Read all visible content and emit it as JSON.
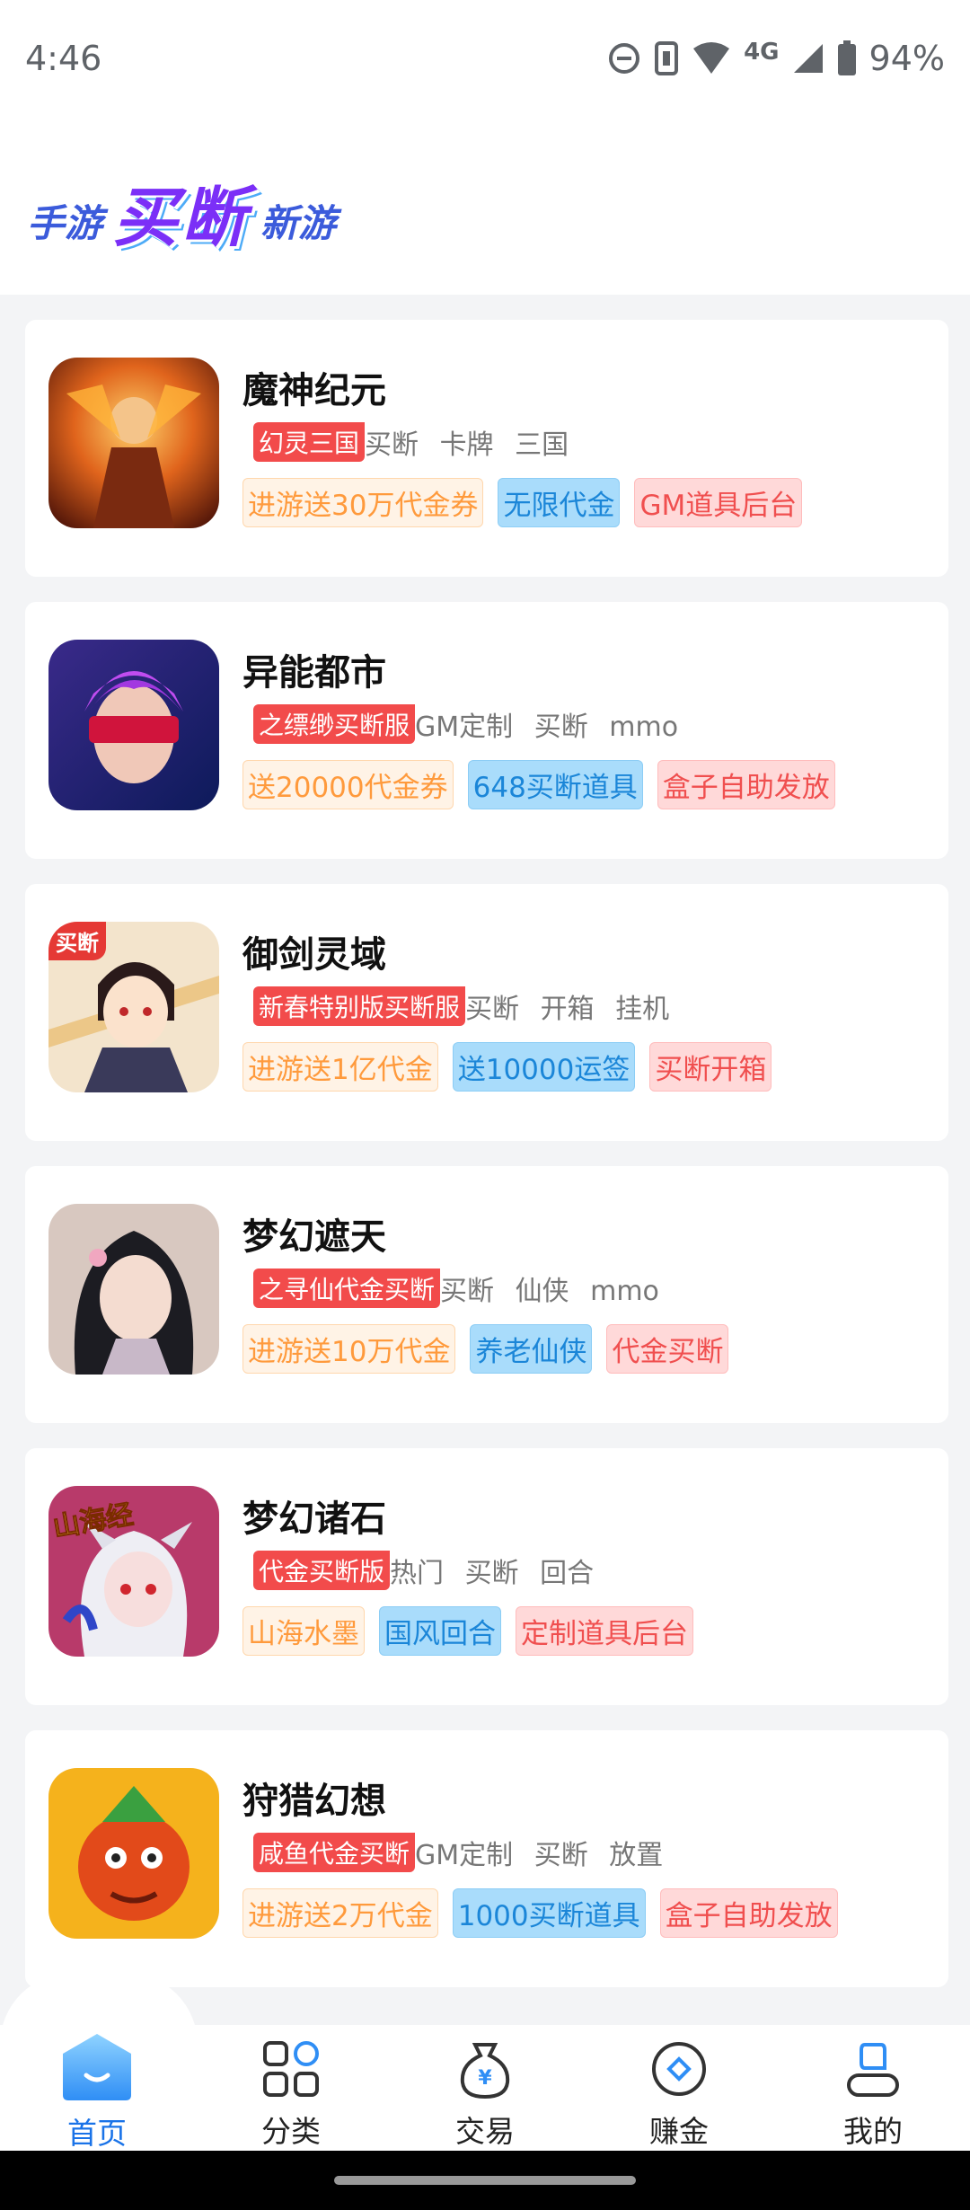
{
  "status_bar": {
    "time": "4:46",
    "network": "4G",
    "battery": "94%"
  },
  "header": {
    "logo_left": "手游",
    "logo_main": "买断",
    "logo_right": "新游"
  },
  "games": [
    {
      "title": "魔神纪元",
      "badge": "幻灵三国",
      "tags": [
        "买断",
        "卡牌",
        "三国"
      ],
      "pills": [
        {
          "text": "进游送30万代金券",
          "color": "orange"
        },
        {
          "text": "无限代金",
          "color": "blue"
        },
        {
          "text": "GM道具后台",
          "color": "pink"
        }
      ]
    },
    {
      "title": "异能都市",
      "badge": "之缥缈买断服",
      "tags": [
        "GM定制",
        "买断",
        "mmo"
      ],
      "pills": [
        {
          "text": "送20000代金券",
          "color": "orange"
        },
        {
          "text": "648买断道具",
          "color": "blue"
        },
        {
          "text": "盒子自助发放",
          "color": "pink"
        }
      ]
    },
    {
      "title": "御剑灵域",
      "badge": "新春特别版买断服",
      "tags": [
        "买断",
        "开箱",
        "挂机"
      ],
      "pills": [
        {
          "text": "进游送1亿代金",
          "color": "orange"
        },
        {
          "text": "送10000运签",
          "color": "blue"
        },
        {
          "text": "买断开箱",
          "color": "pink"
        }
      ]
    },
    {
      "title": "梦幻遮天",
      "badge": "之寻仙代金买断",
      "tags": [
        "买断",
        "仙侠",
        "mmo"
      ],
      "pills": [
        {
          "text": "进游送10万代金",
          "color": "orange"
        },
        {
          "text": "养老仙侠",
          "color": "blue"
        },
        {
          "text": "代金买断",
          "color": "pink"
        }
      ]
    },
    {
      "title": "梦幻诸石",
      "badge": "代金买断版",
      "tags": [
        "热门",
        "买断",
        "回合"
      ],
      "pills": [
        {
          "text": "山海水墨",
          "color": "orange"
        },
        {
          "text": "国风回合",
          "color": "blue"
        },
        {
          "text": "定制道具后台",
          "color": "pink"
        }
      ]
    },
    {
      "title": "狩猎幻想",
      "badge": "咸鱼代金买断",
      "tags": [
        "GM定制",
        "买断",
        "放置"
      ],
      "pills": [
        {
          "text": "进游送2万代金",
          "color": "orange"
        },
        {
          "text": "1000买断道具",
          "color": "blue"
        },
        {
          "text": "盒子自助发放",
          "color": "pink"
        }
      ]
    }
  ],
  "icon_labels": {
    "game3_corner": "买断",
    "game5_corner": "山海经"
  },
  "bottom_nav": [
    {
      "label": "首页",
      "icon": "home-icon",
      "active": true
    },
    {
      "label": "分类",
      "icon": "category-icon",
      "active": false
    },
    {
      "label": "交易",
      "icon": "trade-icon",
      "active": false
    },
    {
      "label": "赚金",
      "icon": "earn-icon",
      "active": false
    },
    {
      "label": "我的",
      "icon": "profile-icon",
      "active": false
    }
  ],
  "colors": {
    "accent": "#1a73e8",
    "badge_red": "#f24b4b",
    "pill_orange": "#ff9a3c",
    "pill_blue": "#1b86d8",
    "pill_pink": "#f04f4f"
  }
}
